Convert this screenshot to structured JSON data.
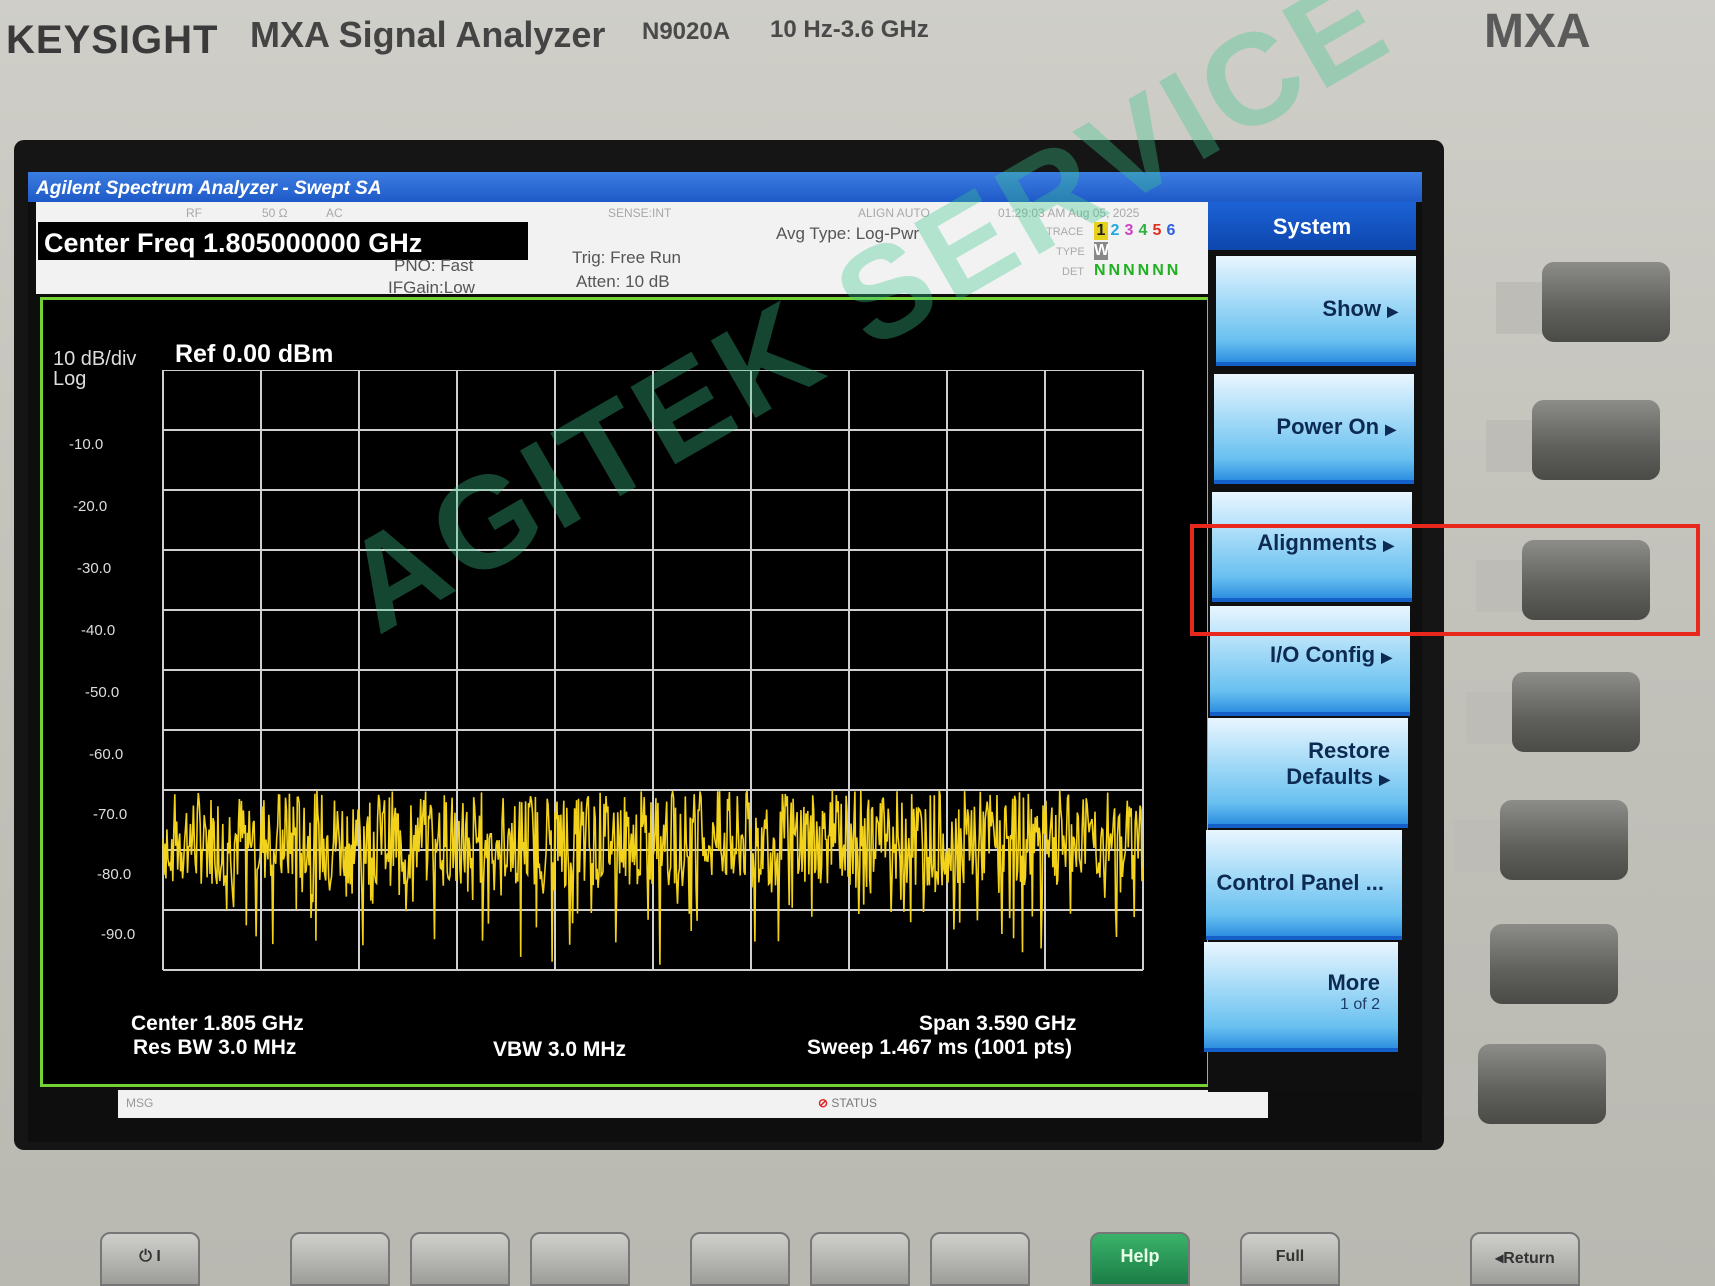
{
  "instrument": {
    "brand": "KEYSIGHT",
    "model": "MXA Signal Analyzer",
    "model_number": "N9020A",
    "freq_range": "10 Hz-3.6 GHz",
    "series_badge": "MXA"
  },
  "window": {
    "title": "Agilent Spectrum Analyzer - Swept SA"
  },
  "annotation": {
    "center_freq": "Center Freq 1.805000000 GHz",
    "pno": "PNO: Fast",
    "ifgain": "IFGain:Low",
    "trigger": "Trig: Free Run",
    "atten": "Atten: 10 dB",
    "avg_type": "Avg Type: Log-Pwr",
    "tiny_rf": "RF",
    "tiny_50": "50 Ω",
    "tiny_ac": "AC",
    "tiny_sense": "SENSE:INT",
    "tiny_align": "ALIGN AUTO",
    "timestamp": "01:29:03 AM Aug 05, 2025",
    "trace_label": "TRACE",
    "type_label": "TYPE",
    "det_label": "DET",
    "trace_numbers": [
      "1",
      "2",
      "3",
      "4",
      "5",
      "6"
    ],
    "trace_type": "W",
    "det_values": "NNNNNN"
  },
  "graph": {
    "scale": "10 dB/div",
    "scale_type": "Log",
    "ref_level": "Ref 0.00 dBm",
    "y_labels": [
      "-10.0",
      "-20.0",
      "-30.0",
      "-40.0",
      "-50.0",
      "-60.0",
      "-70.0",
      "-80.0",
      "-90.0"
    ],
    "center": "Center 1.805 GHz",
    "res_bw": "Res BW 3.0 MHz",
    "vbw": "VBW 3.0 MHz",
    "span": "Span 3.590 GHz",
    "sweep": "Sweep  1.467 ms (1001 pts)",
    "trace_color": "#f2d21a",
    "grid_color": "#cfcfcf",
    "noise_floor_db": -78
  },
  "status_bar": {
    "msg": "MSG",
    "status": "STATUS"
  },
  "softkeys": {
    "title": "System",
    "items": [
      {
        "label": "Show",
        "sub": ""
      },
      {
        "label": "Power On",
        "sub": ""
      },
      {
        "label": "Alignments",
        "sub": ""
      },
      {
        "label": "I/O Config",
        "sub": ""
      },
      {
        "label": "Restore",
        "label2": "Defaults",
        "sub": ""
      },
      {
        "label": "Control Panel ...",
        "sub": ""
      },
      {
        "label": "More",
        "sub": "1 of 2"
      }
    ]
  },
  "bottom_keys": {
    "help": "Help",
    "full": "Full",
    "return": "Return"
  },
  "watermark": "AGITEK SERVICE",
  "highlight_color": "#e8281c"
}
